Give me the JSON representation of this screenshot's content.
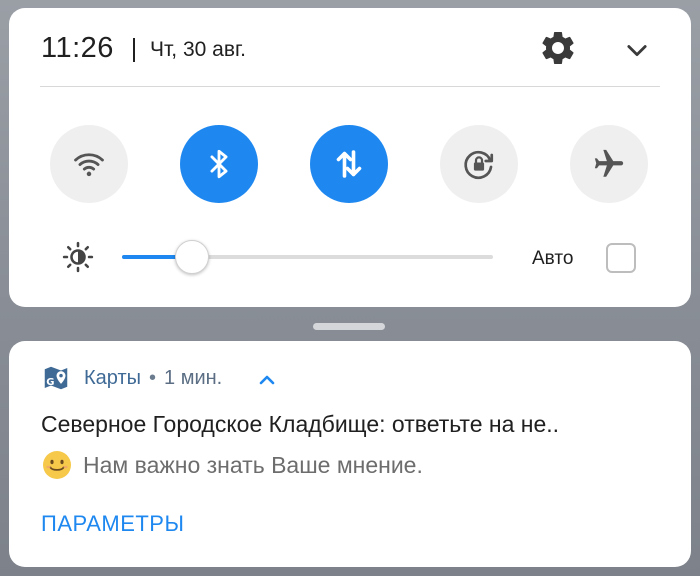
{
  "status": {
    "time": "11:26",
    "date": "Чт, 30 авг."
  },
  "icons": {
    "settings": "gear-icon",
    "collapse": "chevron-down-icon",
    "wifi": "wifi-icon",
    "bluetooth": "bluetooth-icon",
    "mobile_data": "mobile-data-icon",
    "rotation": "rotation-lock-icon",
    "airplane": "airplane-icon",
    "brightness": "brightness-icon",
    "app": "maps-app-icon",
    "expand": "chevron-up-icon",
    "emoji": "smiling-face-emoji"
  },
  "quick_tiles": [
    {
      "id": "wifi",
      "active": false
    },
    {
      "id": "bluetooth",
      "active": true
    },
    {
      "id": "mobile_data",
      "active": true
    },
    {
      "id": "rotation_lock",
      "active": false
    },
    {
      "id": "airplane_mode",
      "active": false
    }
  ],
  "brightness": {
    "level": 0.19,
    "auto_label": "Авто",
    "auto_checked": false
  },
  "notification": {
    "app_name": "Карты",
    "separator": "•",
    "time_ago": "1 мин.",
    "title": "Северное Городское Кладбище: ответьте на не..",
    "text": "Нам важно знать Ваше мнение.",
    "action": "ПАРАМЕТРЫ"
  },
  "colors": {
    "accent": "#1e88f0",
    "tile_off": "#efefef",
    "app_name": "#3f6a96"
  }
}
